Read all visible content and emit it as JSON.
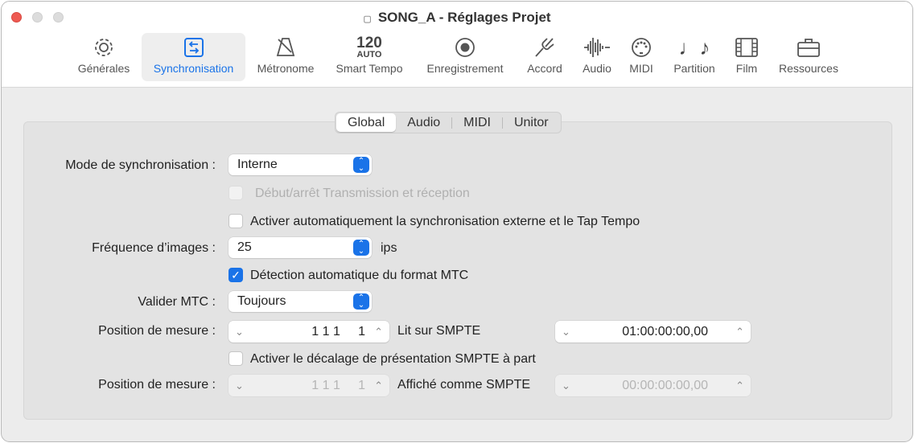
{
  "window": {
    "title": "SONG_A - Réglages Projet"
  },
  "toolbar": [
    {
      "label": "Générales",
      "icon": "gear-icon"
    },
    {
      "label": "Synchronisation",
      "icon": "sync-arrows-icon",
      "selected": true
    },
    {
      "label": "Métronome",
      "icon": "metronome-icon"
    },
    {
      "label": "Smart Tempo",
      "icon_text_top": "120",
      "icon_text_bottom": "AUTO"
    },
    {
      "label": "Enregistrement",
      "icon": "record-icon"
    },
    {
      "label": "Accord",
      "icon": "tuning-fork-icon"
    },
    {
      "label": "Audio",
      "icon": "waveform-icon"
    },
    {
      "label": "MIDI",
      "icon": "midi-port-icon"
    },
    {
      "label": "Partition",
      "icon": "music-notes-icon"
    },
    {
      "label": "Film",
      "icon": "film-icon"
    },
    {
      "label": "Ressources",
      "icon": "briefcase-icon"
    }
  ],
  "tabs": [
    "Global",
    "Audio",
    "MIDI",
    "Unitor"
  ],
  "form": {
    "sync_mode_label": "Mode de synchronisation :",
    "sync_mode_value": "Interne",
    "transmit_label": "Début/arrêt Transmission et réception",
    "auto_ext_label": "Activer automatiquement la synchronisation externe et le Tap Tempo",
    "frame_rate_label": "Fréquence d’images :",
    "frame_rate_value": "25",
    "frame_rate_unit": "ips",
    "mtc_detect_label": "Détection automatique du format MTC",
    "validate_mtc_label": "Valider MTC :",
    "validate_mtc_value": "Toujours",
    "bar_pos_label": "Position de mesure :",
    "bar_pos_value": "1 1 1     1",
    "plays_smpte_label": "Lit sur SMPTE",
    "plays_smpte_value": "01:00:00:00,00",
    "offset_label": "Activer le décalage de présentation SMPTE à part",
    "bar_pos2_label": "Position de mesure :",
    "bar_pos2_value": "1 1 1     1",
    "display_smpte_label": "Affiché comme SMPTE",
    "display_smpte_value": "00:00:00:00,00"
  },
  "colors": {
    "accent": "#1a73e8",
    "close": "#ee5a52"
  }
}
